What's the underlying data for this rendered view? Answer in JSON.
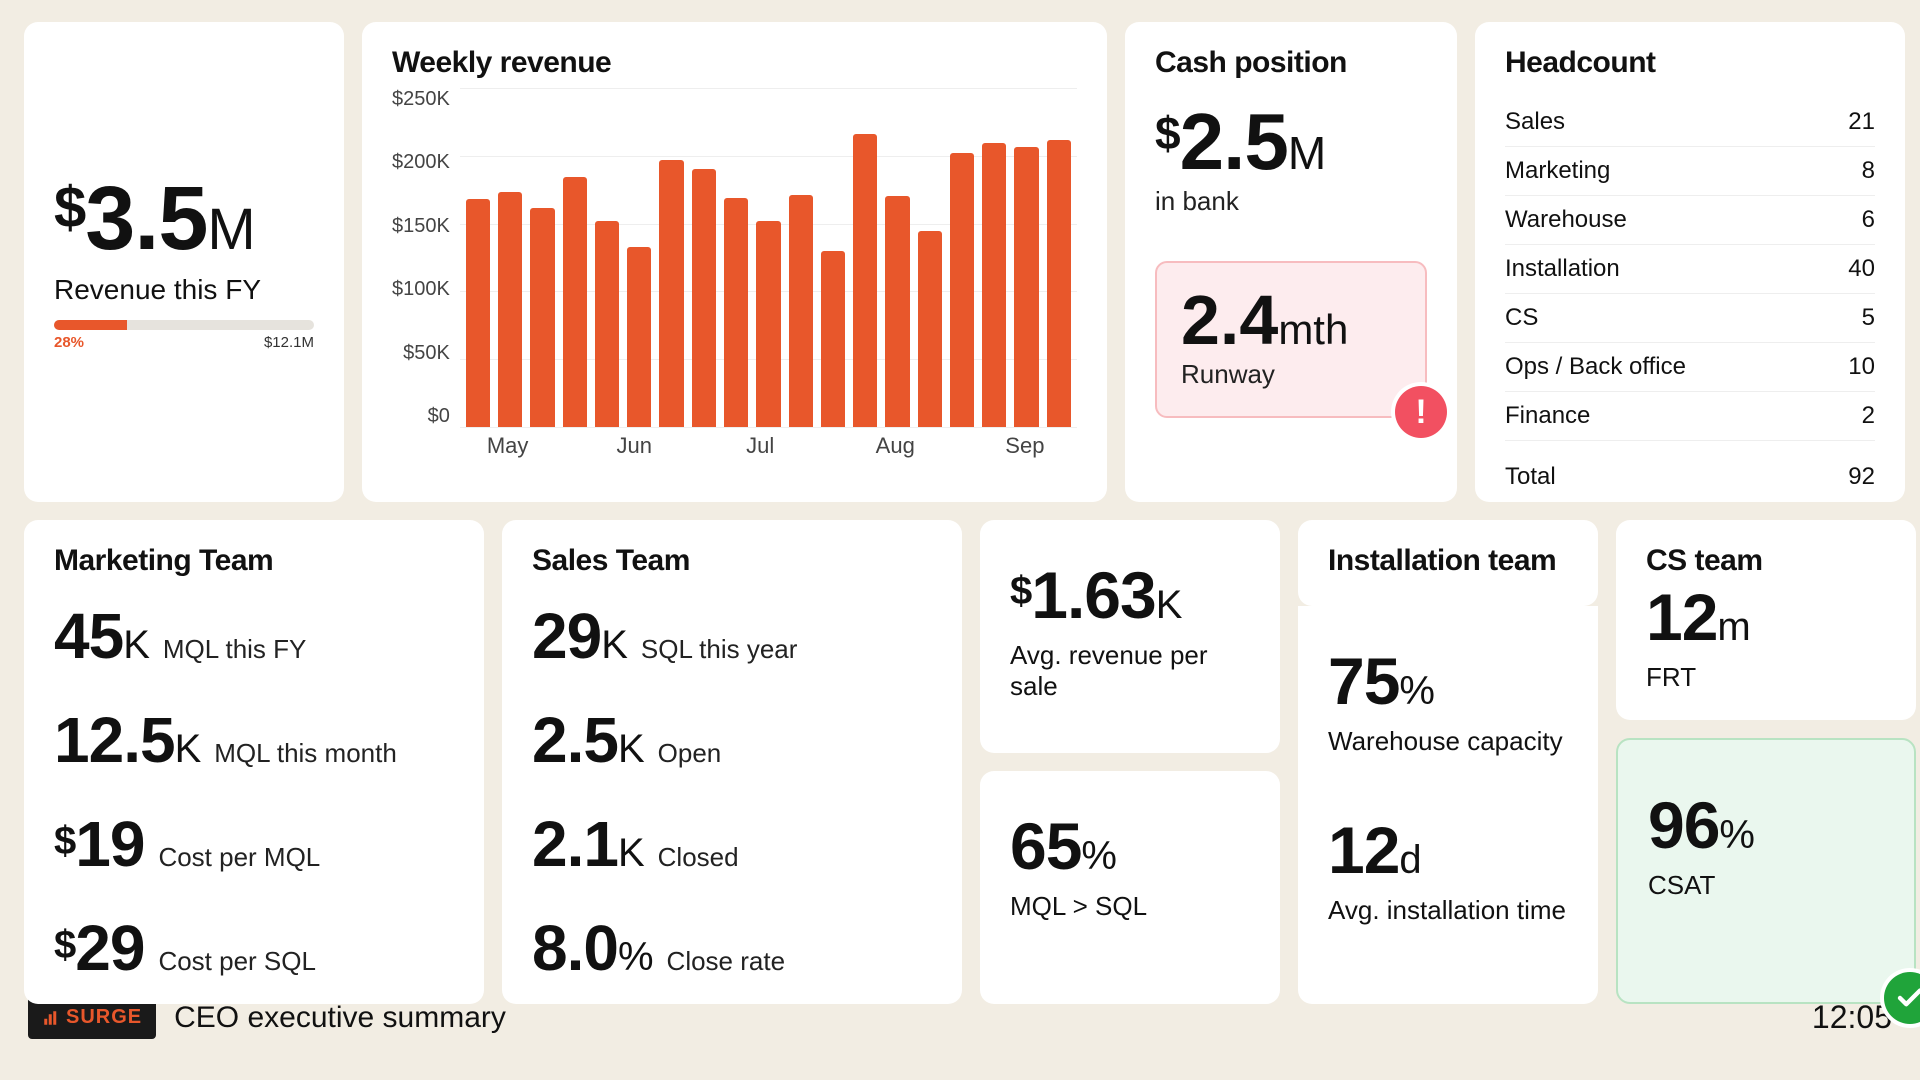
{
  "revenue_fy": {
    "prefix": "$",
    "value": "3.5",
    "unit": "M",
    "label": "Revenue this FY",
    "progress_pct": 28,
    "progress_pct_label": "28%",
    "target_label": "$12.1M"
  },
  "cash": {
    "title": "Cash position",
    "prefix": "$",
    "value": "2.5",
    "unit": "M",
    "sub": "in bank",
    "runway_value": "2.4",
    "runway_unit": "mth",
    "runway_label": "Runway"
  },
  "headcount": {
    "title": "Headcount",
    "rows": [
      {
        "label": "Sales",
        "value": "21"
      },
      {
        "label": "Marketing",
        "value": "8"
      },
      {
        "label": "Warehouse",
        "value": "6"
      },
      {
        "label": "Installation",
        "value": "40"
      },
      {
        "label": "CS",
        "value": "5"
      },
      {
        "label": "Ops / Back office",
        "value": "10"
      },
      {
        "label": "Finance",
        "value": "2"
      }
    ],
    "total_label": "Total",
    "total_value": "92"
  },
  "marketing": {
    "title": "Marketing Team",
    "metrics": [
      {
        "prefix": "",
        "value": "45",
        "unit": "K",
        "label": "MQL this FY"
      },
      {
        "prefix": "",
        "value": "12.5",
        "unit": "K",
        "label": "MQL this month"
      },
      {
        "prefix": "$",
        "value": "19",
        "unit": "",
        "label": "Cost per MQL"
      },
      {
        "prefix": "$",
        "value": "29",
        "unit": "",
        "label": "Cost per SQL"
      }
    ]
  },
  "sales": {
    "title": "Sales Team",
    "metrics": [
      {
        "prefix": "",
        "value": "29",
        "unit": "K",
        "label": "SQL this year"
      },
      {
        "prefix": "",
        "value": "2.5",
        "unit": "K",
        "label": "Open"
      },
      {
        "prefix": "",
        "value": "2.1",
        "unit": "K",
        "label": "Closed"
      },
      {
        "prefix": "",
        "value": "8.0",
        "unit": "%",
        "label": "Close rate"
      }
    ]
  },
  "col_a": {
    "top": {
      "prefix": "$",
      "value": "1.63",
      "unit": "K",
      "label": "Avg. revenue per sale"
    },
    "bottom": {
      "prefix": "",
      "value": "65",
      "unit": "%",
      "label": "MQL > SQL"
    }
  },
  "install": {
    "title": "Installation team",
    "top": {
      "prefix": "",
      "value": "75",
      "unit": "%",
      "label": "Warehouse capacity"
    },
    "bottom": {
      "prefix": "",
      "value": "12",
      "unit": "d",
      "label": "Avg. installation time"
    }
  },
  "cs": {
    "title": "CS team",
    "top": {
      "prefix": "",
      "value": "12",
      "unit": "m",
      "label": "FRT"
    },
    "bottom": {
      "prefix": "",
      "value": "96",
      "unit": "%",
      "label": "CSAT"
    }
  },
  "footer": {
    "logo_text": "SURGE",
    "page_title": "CEO executive summary",
    "clock": "12:05"
  },
  "chart_data": {
    "type": "bar",
    "title": "Weekly revenue",
    "xlabel": "",
    "ylabel": "",
    "ylim": [
      0,
      260000
    ],
    "y_ticks": [
      "$250K",
      "$200K",
      "$150K",
      "$100K",
      "$50K",
      "$0"
    ],
    "x_ticks": [
      "May",
      "Jun",
      "Jul",
      "Aug",
      "Sep"
    ],
    "x_tick_positions_pct": [
      6,
      27,
      48,
      69,
      90
    ],
    "values": [
      175000,
      180000,
      168000,
      192000,
      158000,
      138000,
      205000,
      198000,
      176000,
      158000,
      178000,
      135000,
      225000,
      177000,
      150000,
      210000,
      218000,
      215000,
      220000
    ]
  }
}
